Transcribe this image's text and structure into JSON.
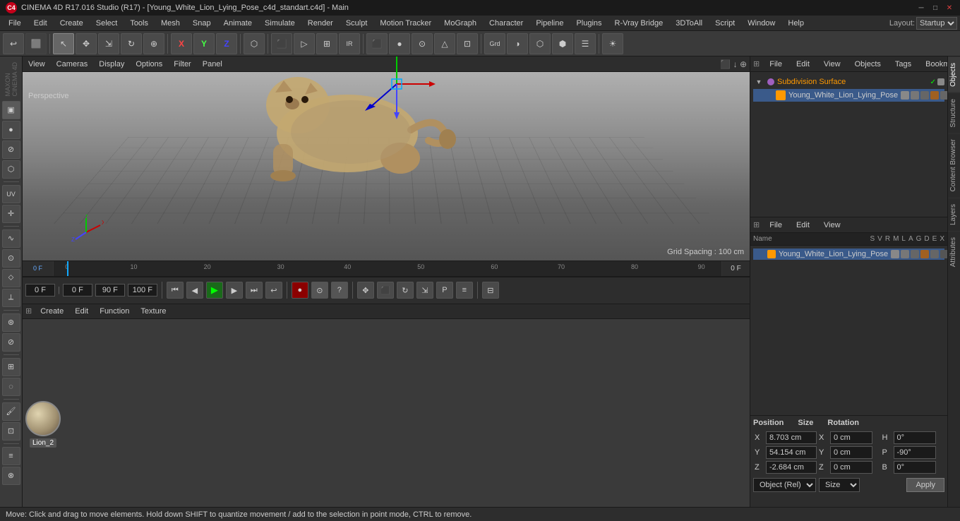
{
  "titlebar": {
    "title": "CINEMA 4D R17.016 Studio (R17) - [Young_White_Lion_Lying_Pose_c4d_standart.c4d] - Main",
    "logo_text": "C4"
  },
  "menubar": {
    "items": [
      "File",
      "Edit",
      "Create",
      "Select",
      "Tools",
      "Mesh",
      "Snap",
      "Animate",
      "Simulate",
      "Render",
      "Sculpt",
      "Motion Tracker",
      "MoGraph",
      "Character",
      "Pipeline",
      "Plugins",
      "R-Vray Bridge",
      "3DToAll",
      "Script",
      "Window",
      "Help"
    ]
  },
  "layout": {
    "label": "Layout:",
    "value": "Startup"
  },
  "viewport": {
    "tabs": [
      "View",
      "Cameras",
      "Display",
      "Options",
      "Filter",
      "Panel"
    ],
    "perspective_label": "Perspective",
    "grid_info": "Grid Spacing : 100 cm"
  },
  "object_manager": {
    "tabs": [
      "File",
      "Edit",
      "View",
      "Objects",
      "Tags",
      "Bookmarks"
    ],
    "objects": [
      {
        "name": "Subdivision Surface",
        "type": "subdivision",
        "indent": 0,
        "active": true
      },
      {
        "name": "Young_White_Lion_Lying_Pose",
        "type": "object",
        "indent": 1,
        "active": false
      }
    ]
  },
  "attributes_manager": {
    "tabs": [
      "File",
      "Edit",
      "View"
    ],
    "columns": [
      "Name",
      "S",
      "V",
      "R",
      "M",
      "L",
      "A",
      "G",
      "D",
      "E",
      "X"
    ],
    "objects": [
      {
        "name": "Young_White_Lion_Lying_Pose",
        "type": "mesh"
      }
    ]
  },
  "coordinates": {
    "position_label": "Position",
    "size_label": "Size",
    "rotation_label": "Rotation",
    "x_pos": "8.703 cm",
    "y_pos": "54.154 cm",
    "z_pos": "-2.684 cm",
    "x_size": "0 cm",
    "y_size": "0 cm",
    "z_size": "0 cm",
    "h_rot": "0°",
    "p_rot": "-90°",
    "b_rot": "0°",
    "object_dropdown": "Object (Rel)",
    "size_dropdown": "Size",
    "apply_label": "Apply"
  },
  "timeline": {
    "start": "0 F",
    "end": "90 F",
    "current": "0 F",
    "fps_label": "100 F",
    "frame_end_label": "0 F",
    "frame_markers": [
      "0",
      "10",
      "20",
      "30",
      "40",
      "50",
      "60",
      "70",
      "80",
      "90"
    ]
  },
  "transport": {
    "current_frame": "0 F",
    "min_frame": "0 F",
    "max_frame": "90 F",
    "fps": "100 F"
  },
  "material": {
    "create_label": "Create",
    "edit_label": "Edit",
    "function_label": "Function",
    "texture_label": "Texture",
    "name": "Lion_2"
  },
  "statusbar": {
    "text": "Move: Click and drag to move elements. Hold down SHIFT to quantize movement / add to the selection in point mode, CTRL to remove."
  },
  "right_tabs": [
    "Objects",
    "Structure",
    "Content Browser",
    "Layers",
    "Attributes"
  ],
  "sidebar_tools": [
    "undo",
    "redo",
    "select",
    "move",
    "scale-tool",
    "rotate-tool",
    "universal",
    "camera",
    "x-axis",
    "y-axis",
    "z-axis",
    "world-space",
    "render-region",
    "render-active",
    "render-all",
    "ir",
    "cube",
    "sphere",
    "cylinder",
    "cone",
    "group",
    "null",
    "camera-obj",
    "light",
    "viewport-solo",
    "view-toggle"
  ]
}
